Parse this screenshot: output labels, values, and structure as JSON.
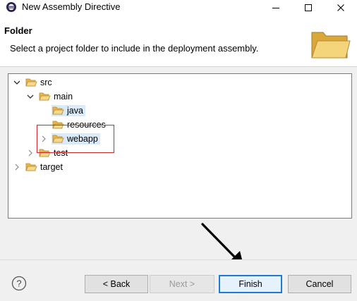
{
  "window": {
    "title": "New Assembly Directive",
    "minimize_glyph": "—",
    "maximize_glyph": "☐",
    "close_glyph": "✕"
  },
  "header": {
    "title": "Folder",
    "description": "Select a project folder to include in the deployment assembly.",
    "icon": "folder-open-icon"
  },
  "tree": {
    "items": [
      {
        "label": "src",
        "expanded": true
      },
      {
        "label": "main",
        "expanded": true
      },
      {
        "label": "java",
        "selected": true
      },
      {
        "label": "resources"
      },
      {
        "label": "webapp",
        "selected": true,
        "expandable": true
      },
      {
        "label": "test",
        "expandable": true
      },
      {
        "label": "target",
        "expandable": true
      }
    ]
  },
  "buttons": {
    "back": "< Back",
    "next": "Next >",
    "finish": "Finish",
    "cancel": "Cancel",
    "help_glyph": "?"
  },
  "colors": {
    "selection": "#d9ebfa",
    "highlight_box": "#d4272c",
    "default_button_border": "#1f7ad4",
    "folder": "#e8b64c"
  }
}
